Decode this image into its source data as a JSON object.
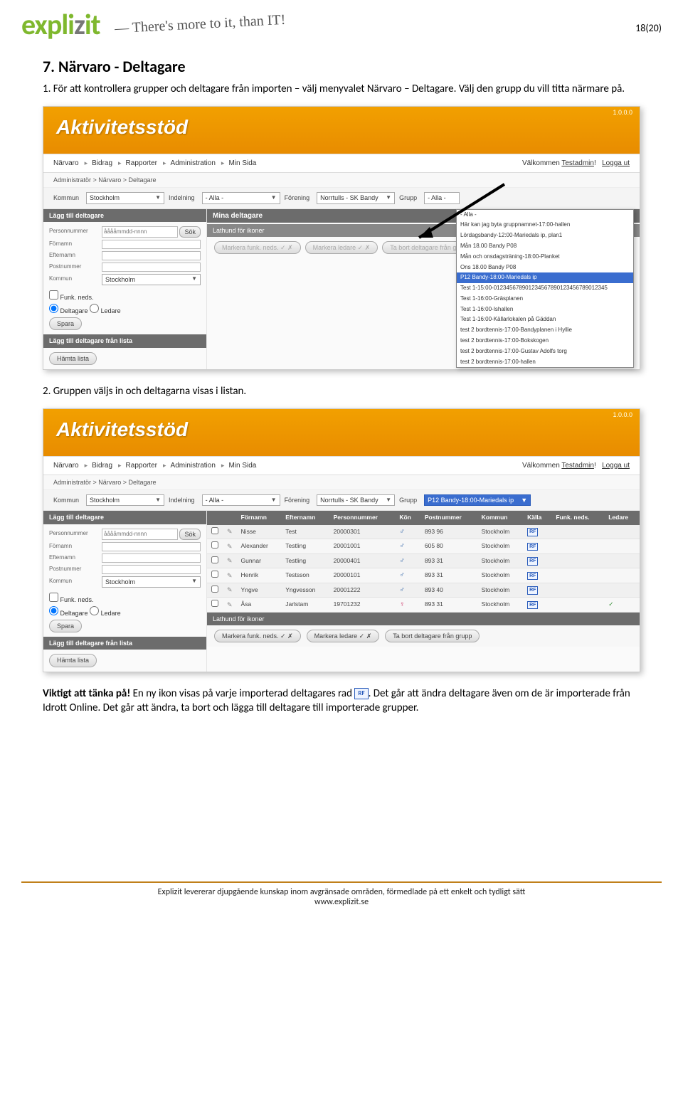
{
  "page_indicator": "18(20)",
  "logo": {
    "part1": "expli",
    "part2": "z",
    "part3": "it"
  },
  "tagline": "— There's more to it, than IT!",
  "section_title": "7. Närvaro - Deltagare",
  "step1": "1. För att kontrollera grupper och deltagare från importen – välj menyvalet Närvaro – Deltagare. Välj den grupp du vill titta närmare på.",
  "step2": "2. Gruppen väljs in och deltagarna visas i listan.",
  "note_bold": "Viktigt att tänka på!",
  "note_part1": " En ny ikon visas på varje importerad deltagares rad ",
  "note_part2": ". Det går att ändra deltagare även om de är importerade från Idrott Online. Det går att ändra, ta bort och lägga till deltagare till importerade grupper.",
  "app_title": "Aktivitetsstöd",
  "version": "1.0.0.0",
  "nav": [
    "Närvaro",
    "Bidrag",
    "Rapporter",
    "Administration",
    "Min Sida"
  ],
  "welcome": "Välkommen ",
  "welcome_user": "Testadmin",
  "logout": "Logga ut",
  "breadcrumb": "Administratör > Närvaro > Deltagare",
  "filters": {
    "kommun_label": "Kommun",
    "kommun_value": "Stockholm",
    "indelning_label": "Indelning",
    "indelning_value": "- Alla -",
    "forening_label": "Förening",
    "forening_value": "Norrtulls - SK Bandy",
    "grupp_label": "Grupp",
    "grupp_value_all": "- Alla -",
    "grupp_value_selected": "P12 Bandy-18:00-Mariedals ip"
  },
  "sidebar": {
    "head1": "Lägg till deltagare",
    "personnummer_label": "Personnummer",
    "personnummer_ph": "ååååmmdd-nnnn",
    "fornamn_label": "Förnamn",
    "efternamn_label": "Efternamn",
    "postnummer_label": "Postnummer",
    "kommun_label": "Kommun",
    "kommun_value": "Stockholm",
    "funkneds_label": "Funk. neds.",
    "deltagare_label": "Deltagare",
    "ledare_label": "Ledare",
    "spara": "Spara",
    "sok": "Sök",
    "head2": "Lägg till deltagare från lista",
    "hamta": "Hämta lista"
  },
  "mina_deltagare": "Mina deltagare",
  "lathund_link": "Lathund för ikoner",
  "action_btns": {
    "markera_funk": "Markera funk. neds.",
    "markera_ledare": "Markera ledare",
    "tabort": "Ta bort deltagare från grupp"
  },
  "dropdown_items": [
    "- Alla -",
    "Här kan jag byta gruppnamnet-17:00-hallen",
    "Lördagsbandy-12:00-Mariedals ip, plan1",
    "Mån 18.00 Bandy P08",
    "Mån och onsdagsträning-18:00-Planket",
    "Ons 18.00 Bandy P08",
    "P12 Bandy-18:00-Mariedals ip",
    "Test 1-15:00-012345678901234567890123456789012345",
    "Test 1-16:00-Gräsplanen",
    "Test 1-16:00-Ishallen",
    "Test 1-16:00-Källarlokalen på Gäddan",
    "test 2 bordtennis-17:00-Bandyplanen i Hyllie",
    "test 2 bordtennis-17:00-Bokskogen",
    "test 2 bordtennis-17:00-Gustav Adolfs torg",
    "test 2 bordtennis-17:00-hallen"
  ],
  "table": {
    "headers": [
      "",
      "",
      "Förnamn",
      "Efternamn",
      "Personnummer",
      "Kön",
      "Postnummer",
      "Kommun",
      "Källa",
      "Funk. neds.",
      "Ledare"
    ],
    "rows": [
      {
        "fornamn": "Nisse",
        "efternamn": "Test",
        "pnr": "20000301",
        "kon": "m",
        "post": "893 96",
        "kommun": "Stockholm"
      },
      {
        "fornamn": "Alexander",
        "efternamn": "Testling",
        "pnr": "20001001",
        "kon": "m",
        "post": "605 80",
        "kommun": "Stockholm"
      },
      {
        "fornamn": "Gunnar",
        "efternamn": "Testling",
        "pnr": "20000401",
        "kon": "m",
        "post": "893 31",
        "kommun": "Stockholm"
      },
      {
        "fornamn": "Henrik",
        "efternamn": "Testsson",
        "pnr": "20000101",
        "kon": "m",
        "post": "893 31",
        "kommun": "Stockholm"
      },
      {
        "fornamn": "Yngve",
        "efternamn": "Yngvesson",
        "pnr": "20001222",
        "kon": "m",
        "post": "893 40",
        "kommun": "Stockholm"
      },
      {
        "fornamn": "Åsa",
        "efternamn": "Jarlstam",
        "pnr": "19701232",
        "kon": "f",
        "post": "893 31",
        "kommun": "Stockholm",
        "ledare": true
      }
    ]
  },
  "rf_text": "RF",
  "footer_line1": "Explizit levererar djupgående kunskap inom avgränsade områden, förmedlade på ett enkelt och tydligt sätt",
  "footer_line2": "www.explizit.se"
}
